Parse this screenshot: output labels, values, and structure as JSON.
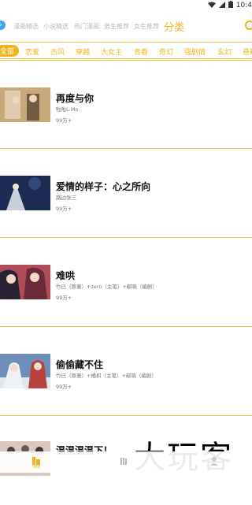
{
  "status_bar": {
    "time": "10:4"
  },
  "top_nav": {
    "tabs": [
      "漫画精选",
      "小说精选",
      "热门漫画",
      "男生推荐",
      "女生推荐"
    ],
    "active": "分类"
  },
  "filters": {
    "active": "全部",
    "items": [
      "恋爱",
      "古风",
      "穿越",
      "大女主",
      "青春",
      "奇幻",
      "强剧情",
      "玄幻",
      "悬疑"
    ]
  },
  "items": [
    {
      "title": "再度与你",
      "authors": "啦啦L-Mo",
      "views": "99万+",
      "cover_color": "#c8a97a"
    },
    {
      "title": "爱情的样子：心之所向",
      "authors": "路边张三",
      "views": "99万+",
      "cover_color": "#1d2a52"
    },
    {
      "title": "难哄",
      "authors": "竹已（原著）+zero（主笔）+郗晓（编剧）",
      "views": "99万+",
      "cover_color": "#b04c5a"
    },
    {
      "title": "偷偷藏不住",
      "authors": "竹已（原著）+橘枳（主笔）+郗晓（编剧）",
      "views": "99万+",
      "cover_color": "#6f8fb8"
    },
    {
      "title": "温温温温下！",
      "authors": "",
      "views": "",
      "cover_color": "#d9c7c0"
    }
  ],
  "bottom_nav": {
    "items": [
      {
        "label": "书架",
        "icon": "bookshelf-icon"
      },
      {
        "label": "",
        "icon": "books-icon"
      },
      {
        "label": "",
        "icon": "user-icon"
      }
    ]
  },
  "watermark": "大玩客",
  "colors": {
    "accent": "#f5b11c",
    "divider": "#f3c64d"
  }
}
